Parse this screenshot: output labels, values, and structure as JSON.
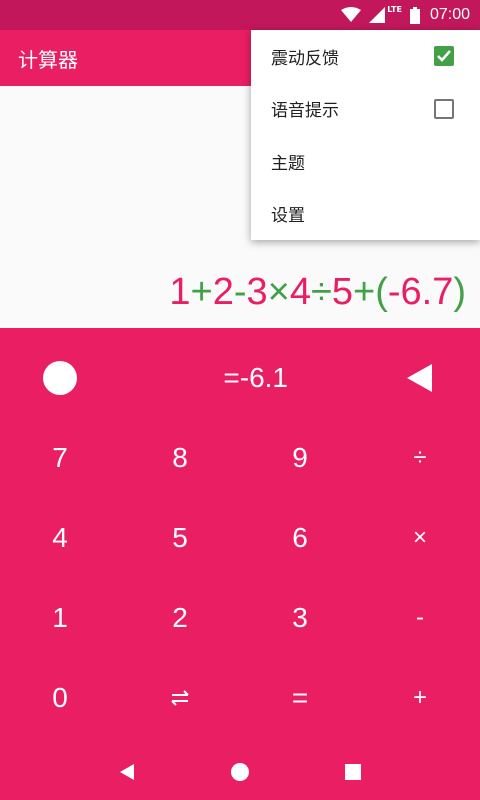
{
  "status": {
    "network": "LTE",
    "time": "07:00"
  },
  "app": {
    "title": "计算器"
  },
  "display": {
    "expression_tokens": [
      {
        "text": "1",
        "color": "#e91e63"
      },
      {
        "text": "+",
        "color": "#43a047"
      },
      {
        "text": "2",
        "color": "#e91e63"
      },
      {
        "text": "-",
        "color": "#43a047"
      },
      {
        "text": "3",
        "color": "#e91e63"
      },
      {
        "text": "×",
        "color": "#43a047"
      },
      {
        "text": "4",
        "color": "#e91e63"
      },
      {
        "text": "÷",
        "color": "#43a047"
      },
      {
        "text": "5",
        "color": "#e91e63"
      },
      {
        "text": "+",
        "color": "#43a047"
      },
      {
        "text": "(",
        "color": "#43a047"
      },
      {
        "text": "-6.7",
        "color": "#e91e63"
      },
      {
        "text": ")",
        "color": "#43a047"
      }
    ],
    "result": "=-6.1"
  },
  "keys": {
    "row1": [
      "7",
      "8",
      "9",
      "÷"
    ],
    "row2": [
      "4",
      "5",
      "6",
      "×"
    ],
    "row3": [
      "1",
      "2",
      "3",
      "-"
    ],
    "row4": [
      "0",
      "⇄",
      "=",
      "+"
    ]
  },
  "menu": {
    "items": [
      {
        "label": "震动反馈",
        "checked": true
      },
      {
        "label": "语音提示",
        "checked": false
      },
      {
        "label": "主题"
      },
      {
        "label": "设置"
      }
    ]
  },
  "colors": {
    "accent": "#e91e63",
    "status_bar": "#c2185b",
    "operator": "#43a047"
  },
  "icons": {
    "circle": "circle-icon",
    "backspace": "backspace-icon",
    "swap": "swap-arrows-icon",
    "nav_back": "nav-back-icon",
    "nav_home": "nav-home-icon",
    "nav_recents": "nav-recents-icon"
  }
}
